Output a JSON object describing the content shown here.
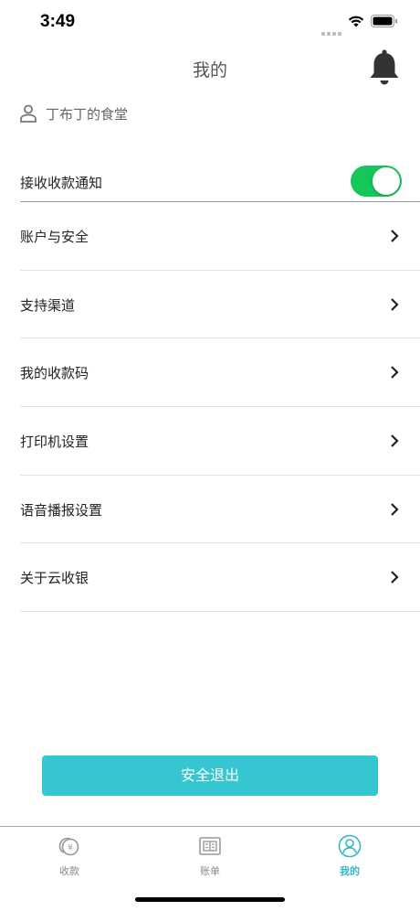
{
  "status_bar": {
    "time": "3:49"
  },
  "header": {
    "title": "我的"
  },
  "store": {
    "name": "丁布丁的食堂"
  },
  "notify": {
    "label": "接收收款通知",
    "enabled": true
  },
  "menu": [
    {
      "label": "账户与安全"
    },
    {
      "label": "支持渠道"
    },
    {
      "label": "我的收款码"
    },
    {
      "label": "打印机设置"
    },
    {
      "label": "语音播报设置"
    },
    {
      "label": "关于云收银"
    }
  ],
  "logout": {
    "label": "安全退出"
  },
  "tabs": [
    {
      "label": "收款",
      "icon": "coin-icon",
      "active": false
    },
    {
      "label": "账单",
      "icon": "bill-icon",
      "active": false
    },
    {
      "label": "我的",
      "icon": "profile-icon",
      "active": true
    }
  ],
  "colors": {
    "accent": "#35c6d2",
    "toggle_on": "#15c65a",
    "tab_active": "#35b9c7"
  }
}
